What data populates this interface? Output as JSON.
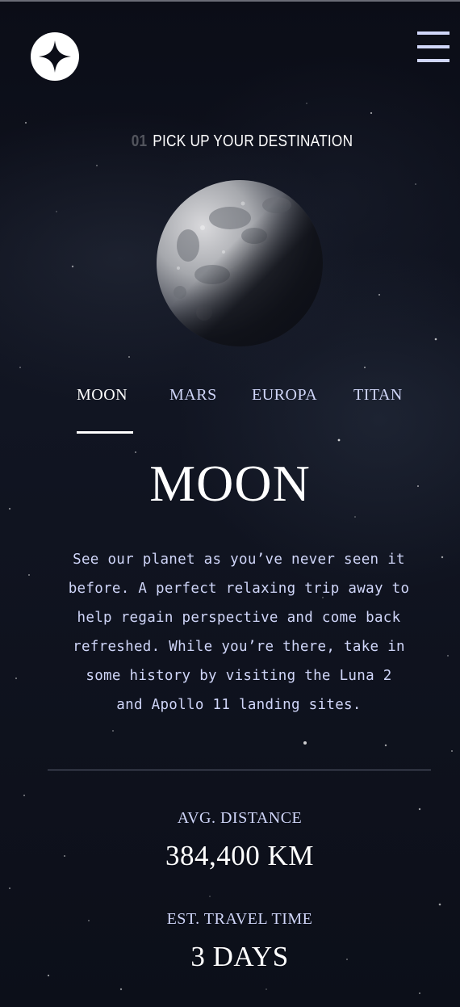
{
  "header": {
    "logo_icon": "star-logo-icon",
    "menu_icon": "hamburger-menu-icon"
  },
  "section": {
    "number": "01",
    "title": "PICK UP YOUR DESTINATION"
  },
  "planet_image": {
    "icon": "moon-image"
  },
  "tabs": [
    {
      "label": "MOON",
      "active": true
    },
    {
      "label": "MARS",
      "active": false
    },
    {
      "label": "EUROPA",
      "active": false
    },
    {
      "label": "TITAN",
      "active": false
    }
  ],
  "destination": {
    "name": "MOON",
    "description_lines": [
      "See our planet as you’ve never seen it",
      "before. A perfect relaxing trip away to",
      "help regain perspective and come back",
      "refreshed. While you’re there, take in",
      "some history by visiting the Luna 2",
      "and Apollo 11 landing sites."
    ]
  },
  "stats": {
    "distance_label": "AVG. DISTANCE",
    "distance_value": "384,400 KM",
    "travel_label": "EST. TRAVEL TIME",
    "travel_value": "3 DAYS"
  },
  "colors": {
    "background": "#0b0d17",
    "accent_light": "#d0d6f9",
    "white": "#ffffff"
  }
}
